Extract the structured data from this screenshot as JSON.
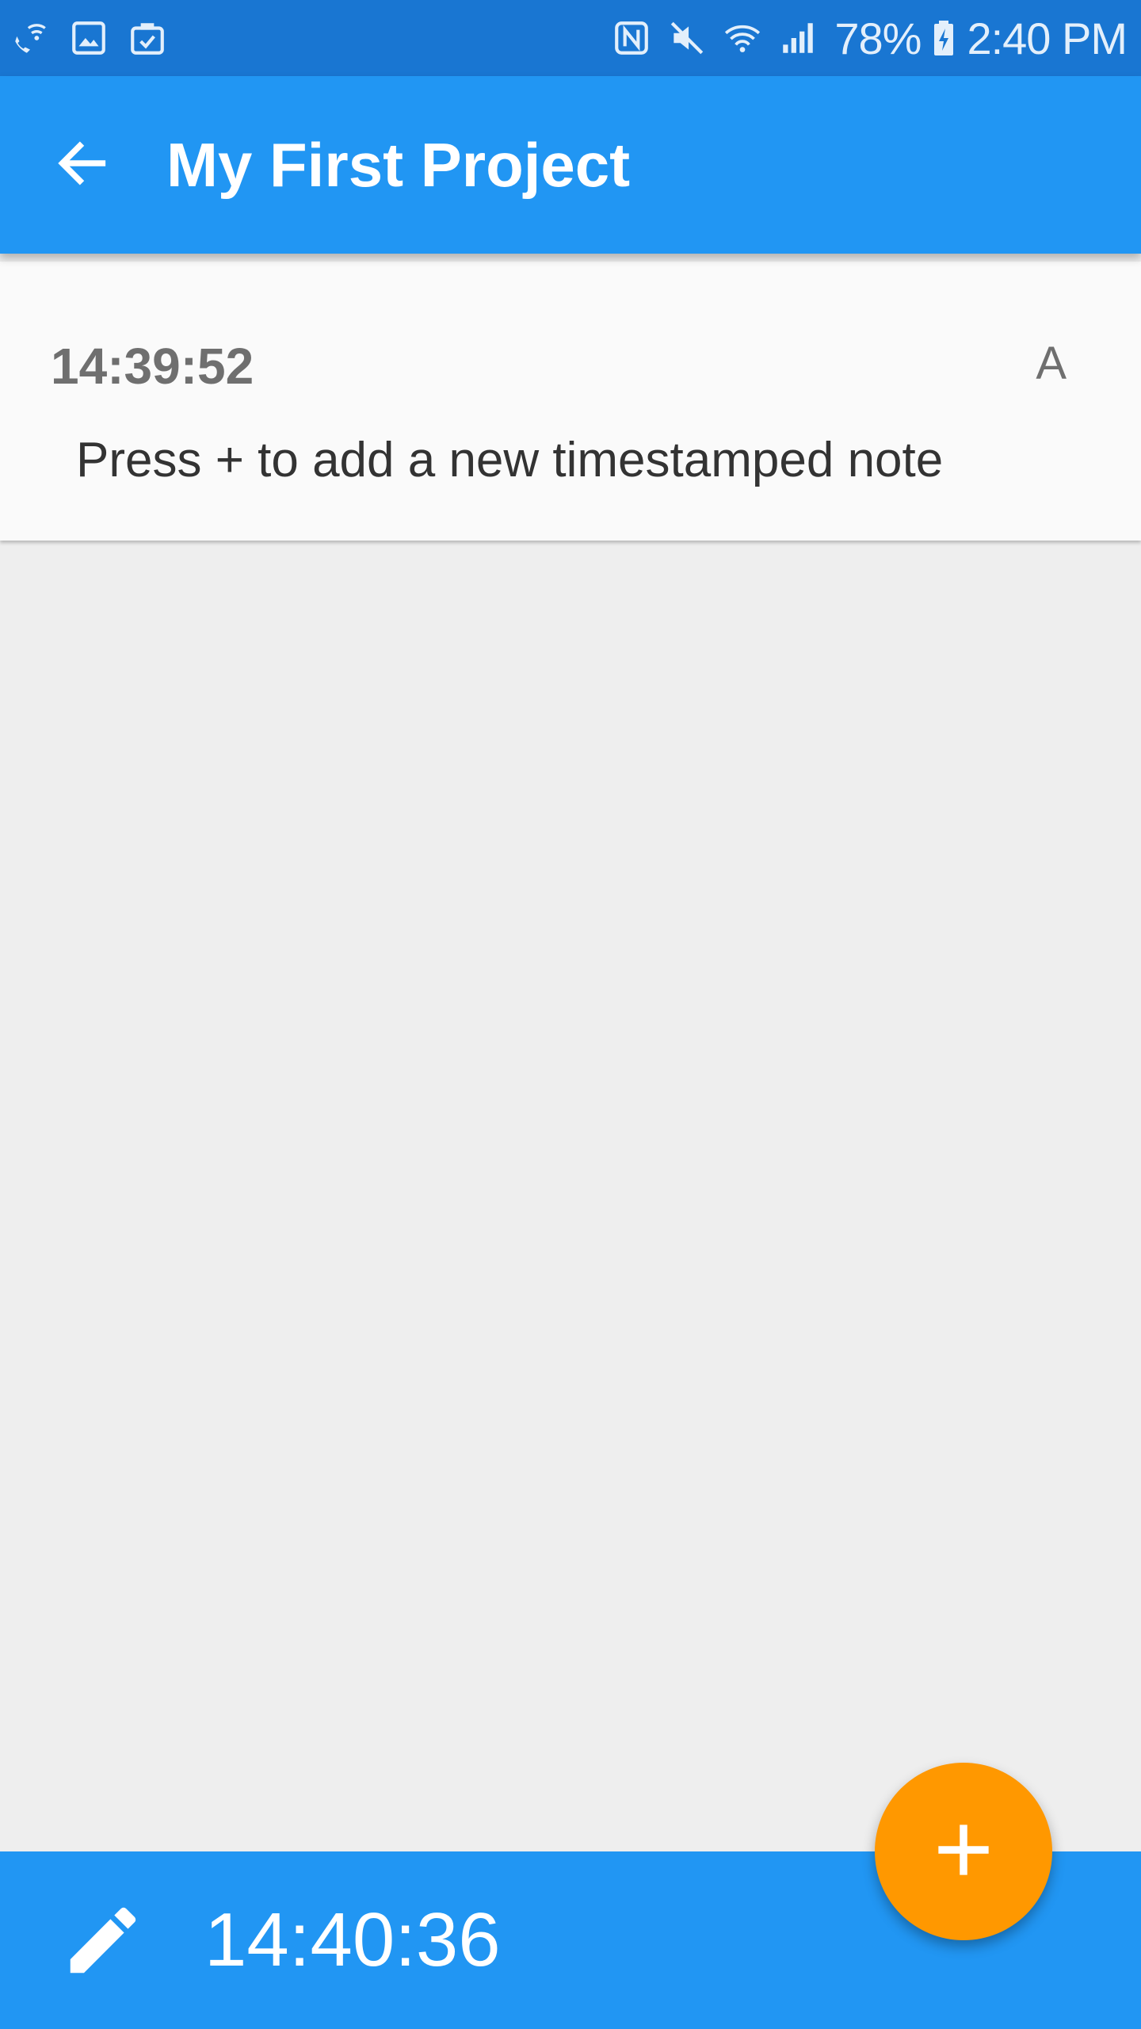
{
  "status_bar": {
    "left_icons": [
      "wifi-calling-icon",
      "gallery-icon",
      "clipboard-check-icon"
    ],
    "right_icons": [
      "nfc-icon",
      "mute-icon",
      "wifi-icon",
      "signal-icon",
      "battery-charging-icon"
    ],
    "battery": "78%",
    "time": "2:40 PM"
  },
  "app_bar": {
    "back_icon": "arrow-back-icon",
    "title": "My First Project"
  },
  "notes": [
    {
      "time": "14:39:52",
      "author": "A",
      "text": "Press + to add a new timestamped note"
    }
  ],
  "bottom_bar": {
    "edit_icon": "pencil-icon",
    "current_time": "14:40:36"
  },
  "fab": {
    "icon": "plus-icon"
  },
  "colors": {
    "status_bar": "#1976d2",
    "primary": "#2196f3",
    "accent": "#ff9800",
    "background": "#eeeeee",
    "card": "#fafafa"
  }
}
